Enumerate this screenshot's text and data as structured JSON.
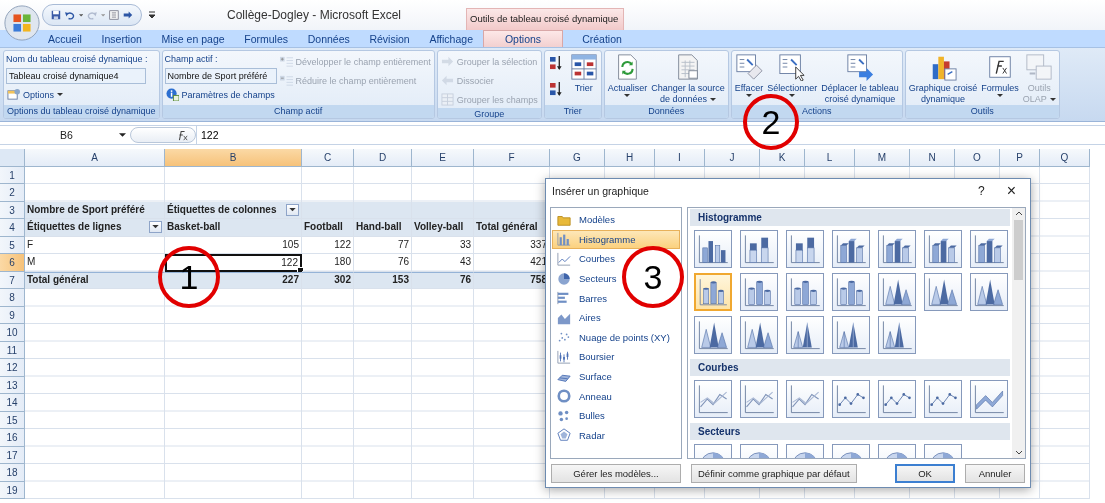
{
  "window": {
    "title": "Collège-Dogley - Microsoft Excel",
    "contextual_title": "Outils de tableau croisé dynamique"
  },
  "tabs": [
    {
      "label": "Accueil",
      "selected": false,
      "contextual": false
    },
    {
      "label": "Insertion",
      "selected": false,
      "contextual": false
    },
    {
      "label": "Mise en page",
      "selected": false,
      "contextual": false
    },
    {
      "label": "Formules",
      "selected": false,
      "contextual": false
    },
    {
      "label": "Données",
      "selected": false,
      "contextual": false
    },
    {
      "label": "Révision",
      "selected": false,
      "contextual": false
    },
    {
      "label": "Affichage",
      "selected": false,
      "contextual": false
    },
    {
      "label": "Options",
      "selected": true,
      "contextual": true
    },
    {
      "label": "Création",
      "selected": false,
      "contextual": true
    }
  ],
  "ribbon": {
    "groups": [
      {
        "title": "Options du tableau croisé dynamique",
        "columns": [
          [
            {
              "kind": "caption",
              "label": "Nom du tableau croisé dynamique :"
            },
            {
              "kind": "field",
              "value": "Tableau croisé dynamique4"
            },
            {
              "kind": "small",
              "label": "Options",
              "disabled": false,
              "dropdown": true
            }
          ]
        ]
      },
      {
        "title": "Champ actif",
        "columns": [
          [
            {
              "kind": "caption",
              "label": "Champ actif :"
            },
            {
              "kind": "field",
              "value": "Nombre de Sport préféré"
            },
            {
              "kind": "small",
              "label": "Paramètres de champs",
              "disabled": false,
              "dropdown": false
            }
          ],
          [
            {
              "kind": "small",
              "label": "Développer le champ entièrement",
              "disabled": true,
              "dropdown": false
            },
            {
              "kind": "small",
              "label": "Réduire le champ entièrement",
              "disabled": true,
              "dropdown": false
            }
          ]
        ]
      },
      {
        "title": "Groupe",
        "columns": [
          [
            {
              "kind": "small",
              "label": "Grouper la sélection",
              "disabled": true,
              "dropdown": false
            },
            {
              "kind": "small",
              "label": "Dissocier",
              "disabled": true,
              "dropdown": false
            },
            {
              "kind": "small",
              "label": "Grouper les champs",
              "disabled": true,
              "dropdown": false
            }
          ]
        ]
      },
      {
        "title": "Trier",
        "columns": [
          [
            {
              "kind": "icon",
              "disabled": false
            },
            {
              "kind": "icon",
              "disabled": false
            }
          ],
          [
            {
              "kind": "large",
              "lines": [
                "Trier"
              ],
              "disabled": false,
              "dropdown": false
            }
          ]
        ]
      },
      {
        "title": "Données",
        "columns": [
          [
            {
              "kind": "large",
              "lines": [
                "Actualiser"
              ],
              "disabled": false,
              "dropdown": true
            }
          ],
          [
            {
              "kind": "large",
              "lines": [
                "Changer la source",
                "de données"
              ],
              "disabled": false,
              "dropdown": true
            }
          ]
        ]
      },
      {
        "title": "Actions",
        "columns": [
          [
            {
              "kind": "large",
              "lines": [
                "Effacer"
              ],
              "disabled": false,
              "dropdown": true
            }
          ],
          [
            {
              "kind": "large",
              "lines": [
                "Sélectionner"
              ],
              "disabled": false,
              "dropdown": true
            }
          ],
          [
            {
              "kind": "large",
              "lines": [
                "Déplacer le tableau",
                "croisé dynamique"
              ],
              "disabled": false,
              "dropdown": false
            }
          ]
        ]
      },
      {
        "title": "Outils",
        "columns": [
          [
            {
              "kind": "large",
              "lines": [
                "Graphique croisé",
                "dynamique"
              ],
              "disabled": false,
              "dropdown": false
            }
          ],
          [
            {
              "kind": "large",
              "lines": [
                "Formules"
              ],
              "disabled": false,
              "dropdown": true
            }
          ],
          [
            {
              "kind": "large",
              "lines": [
                "Outils",
                "OLAP"
              ],
              "disabled": true,
              "dropdown": true
            }
          ]
        ]
      }
    ]
  },
  "formula_bar": {
    "name_box": "B6",
    "formula": "122"
  },
  "sheet": {
    "columns": [
      {
        "label": "A",
        "selected": false
      },
      {
        "label": "B",
        "selected": true
      },
      {
        "label": "C",
        "selected": false
      },
      {
        "label": "D",
        "selected": false
      },
      {
        "label": "E",
        "selected": false
      },
      {
        "label": "F",
        "selected": false
      },
      {
        "label": "G",
        "selected": false
      },
      {
        "label": "H",
        "selected": false
      },
      {
        "label": "I",
        "selected": false
      },
      {
        "label": "J",
        "selected": false
      },
      {
        "label": "K",
        "selected": false
      },
      {
        "label": "L",
        "selected": false
      },
      {
        "label": "M",
        "selected": false
      },
      {
        "label": "N",
        "selected": false
      },
      {
        "label": "O",
        "selected": false
      },
      {
        "label": "P",
        "selected": false
      },
      {
        "label": "Q",
        "selected": false
      }
    ],
    "rows": [
      {
        "label": "1",
        "selected": false,
        "kind": "empty"
      },
      {
        "label": "2",
        "selected": false,
        "kind": "empty"
      },
      {
        "label": "3",
        "selected": false,
        "kind": "header",
        "cells": [
          {
            "kind": "text",
            "text": "Nombre de Sport préféré",
            "selected": false
          },
          {
            "kind": "filter",
            "text": "Étiquettes de colonnes",
            "selected": false
          },
          {
            "kind": "empty",
            "selected": false
          },
          {
            "kind": "empty",
            "selected": false
          },
          {
            "kind": "empty",
            "selected": false
          },
          {
            "kind": "empty",
            "selected": false
          }
        ]
      },
      {
        "label": "4",
        "selected": false,
        "kind": "header",
        "cells": [
          {
            "kind": "filter",
            "text": "Étiquettes de lignes",
            "selected": false
          },
          {
            "kind": "text",
            "text": "Basket-ball",
            "selected": false
          },
          {
            "kind": "text",
            "text": "Football",
            "selected": false
          },
          {
            "kind": "text",
            "text": "Hand-ball",
            "selected": false
          },
          {
            "kind": "text",
            "text": "Volley-ball",
            "selected": false
          },
          {
            "kind": "text",
            "text": "Total général",
            "selected": false
          }
        ]
      },
      {
        "label": "5",
        "selected": false,
        "kind": "data",
        "cells": [
          {
            "kind": "text",
            "text": "F",
            "selected": false
          },
          {
            "kind": "number",
            "text": "105",
            "selected": false
          },
          {
            "kind": "number",
            "text": "122",
            "selected": false
          },
          {
            "kind": "number",
            "text": "77",
            "selected": false
          },
          {
            "kind": "number",
            "text": "33",
            "selected": false
          },
          {
            "kind": "number",
            "text": "337",
            "selected": false
          }
        ]
      },
      {
        "label": "6",
        "selected": true,
        "kind": "data",
        "cells": [
          {
            "kind": "text",
            "text": "M",
            "selected": false
          },
          {
            "kind": "number",
            "text": "122",
            "selected": true
          },
          {
            "kind": "number",
            "text": "180",
            "selected": false
          },
          {
            "kind": "number",
            "text": "76",
            "selected": false
          },
          {
            "kind": "number",
            "text": "43",
            "selected": false
          },
          {
            "kind": "number",
            "text": "421",
            "selected": false
          }
        ]
      },
      {
        "label": "7",
        "selected": false,
        "kind": "total",
        "cells": [
          {
            "kind": "text",
            "text": "Total général",
            "selected": false
          },
          {
            "kind": "number",
            "text": "227",
            "selected": false
          },
          {
            "kind": "number",
            "text": "302",
            "selected": false
          },
          {
            "kind": "number",
            "text": "153",
            "selected": false
          },
          {
            "kind": "number",
            "text": "76",
            "selected": false
          },
          {
            "kind": "number",
            "text": "758",
            "selected": false
          }
        ]
      },
      {
        "label": "8",
        "selected": false,
        "kind": "empty"
      },
      {
        "label": "9",
        "selected": false,
        "kind": "empty"
      },
      {
        "label": "10",
        "selected": false,
        "kind": "empty"
      },
      {
        "label": "11",
        "selected": false,
        "kind": "empty"
      },
      {
        "label": "12",
        "selected": false,
        "kind": "empty"
      },
      {
        "label": "13",
        "selected": false,
        "kind": "empty"
      },
      {
        "label": "14",
        "selected": false,
        "kind": "empty"
      },
      {
        "label": "15",
        "selected": false,
        "kind": "empty"
      },
      {
        "label": "16",
        "selected": false,
        "kind": "empty"
      },
      {
        "label": "17",
        "selected": false,
        "kind": "empty"
      },
      {
        "label": "18",
        "selected": false,
        "kind": "empty"
      },
      {
        "label": "19",
        "selected": false,
        "kind": "empty"
      }
    ]
  },
  "dialog": {
    "title": "Insérer un graphique",
    "help": "?",
    "close": "×",
    "categories": [
      {
        "label": "Modèles",
        "selected": false
      },
      {
        "label": "Histogramme",
        "selected": true
      },
      {
        "label": "Courbes",
        "selected": false
      },
      {
        "label": "Secteurs",
        "selected": false
      },
      {
        "label": "Barres",
        "selected": false
      },
      {
        "label": "Aires",
        "selected": false
      },
      {
        "label": "Nuage de points (XY)",
        "selected": false
      },
      {
        "label": "Boursier",
        "selected": false
      },
      {
        "label": "Surface",
        "selected": false
      },
      {
        "label": "Anneau",
        "selected": false
      },
      {
        "label": "Bulles",
        "selected": false
      },
      {
        "label": "Radar",
        "selected": false
      }
    ],
    "sections": [
      {
        "title": "Histogramme",
        "thumbnails": [
          {
            "kind": "bars",
            "selected": false
          },
          {
            "kind": "stacked",
            "selected": false
          },
          {
            "kind": "stacked",
            "selected": false
          },
          {
            "kind": "bars3d",
            "selected": false
          },
          {
            "kind": "bars3d",
            "selected": false
          },
          {
            "kind": "bars3d",
            "selected": false
          },
          {
            "kind": "bars3d",
            "selected": false
          },
          {
            "kind": "cylinders",
            "selected": true
          },
          {
            "kind": "cylinders",
            "selected": false
          },
          {
            "kind": "cylinders",
            "selected": false
          },
          {
            "kind": "cylinders",
            "selected": false
          },
          {
            "kind": "cones",
            "selected": false
          },
          {
            "kind": "cones",
            "selected": false
          },
          {
            "kind": "cones",
            "selected": false
          },
          {
            "kind": "cones",
            "selected": false
          },
          {
            "kind": "cones",
            "selected": false
          },
          {
            "kind": "pyramids",
            "selected": false
          },
          {
            "kind": "pyramids",
            "selected": false
          },
          {
            "kind": "pyramids",
            "selected": false
          }
        ]
      },
      {
        "title": "Courbes",
        "thumbnails": [
          {
            "kind": "line",
            "selected": false
          },
          {
            "kind": "line",
            "selected": false
          },
          {
            "kind": "line",
            "selected": false
          },
          {
            "kind": "markers",
            "selected": false
          },
          {
            "kind": "markers",
            "selected": false
          },
          {
            "kind": "markers",
            "selected": false
          },
          {
            "kind": "line3d",
            "selected": false
          }
        ]
      },
      {
        "title": "Secteurs",
        "thumbnails": [
          {
            "kind": "pie",
            "selected": false
          },
          {
            "kind": "pie",
            "selected": false
          },
          {
            "kind": "pie",
            "selected": false
          },
          {
            "kind": "pie",
            "selected": false
          },
          {
            "kind": "pie",
            "selected": false
          },
          {
            "kind": "pie",
            "selected": false
          }
        ]
      }
    ],
    "buttons": [
      {
        "label": "Gérer les modèles...",
        "default": false
      },
      {
        "label": "Définir comme graphique par défaut",
        "default": false
      },
      {
        "label": "OK",
        "default": true
      },
      {
        "label": "Annuler",
        "default": false
      }
    ]
  },
  "annotations": [
    {
      "label": "1"
    },
    {
      "label": "2"
    },
    {
      "label": "3"
    }
  ]
}
